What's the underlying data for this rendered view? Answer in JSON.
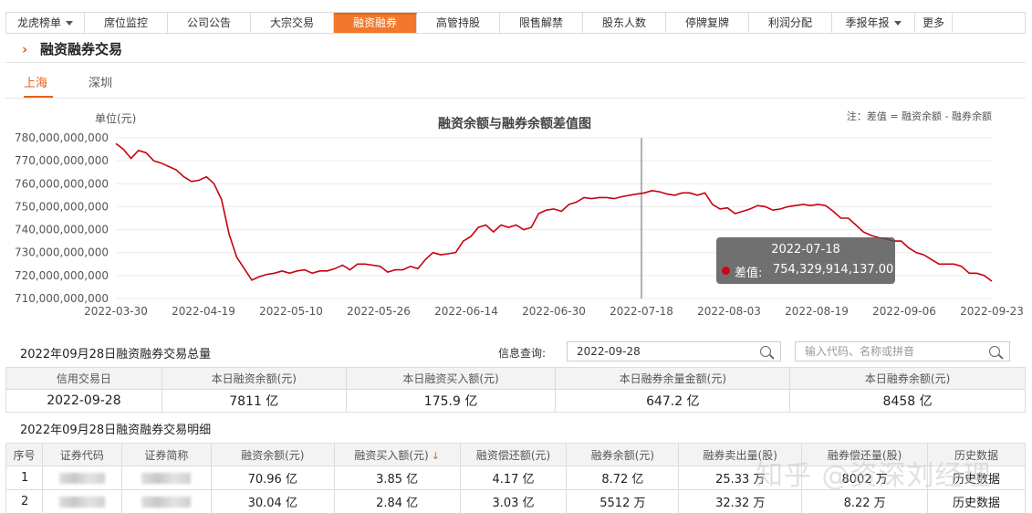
{
  "tabs": [
    {
      "label": "龙虎榜单",
      "dropdown": true
    },
    {
      "label": "席位监控"
    },
    {
      "label": "公司公告"
    },
    {
      "label": "大宗交易"
    },
    {
      "label": "融资融券",
      "active": true
    },
    {
      "label": "高管持股"
    },
    {
      "label": "限售解禁"
    },
    {
      "label": "股东人数"
    },
    {
      "label": "停牌复牌"
    },
    {
      "label": "利润分配"
    },
    {
      "label": "季报年报",
      "dropdown": true
    },
    {
      "label": "更多"
    }
  ],
  "section": {
    "title": "融资融券交易"
  },
  "markets": {
    "shanghai": "上海",
    "shenzhen": "深圳"
  },
  "chart_data": {
    "type": "line",
    "title": "融资余额与融券余额差值图",
    "ylabel": "单位(元)",
    "note": "注：差值 = 融资余额 - 融券余额",
    "series_name": "差值",
    "ylim": [
      710000000000,
      780000000000
    ],
    "y_ticks": [
      "780,000,000,000",
      "770,000,000,000",
      "760,000,000,000",
      "750,000,000,000",
      "740,000,000,000",
      "730,000,000,000",
      "720,000,000,000",
      "710,000,000,000"
    ],
    "x_ticks": [
      "2022-03-30",
      "2022-04-19",
      "2022-05-10",
      "2022-05-26",
      "2022-06-14",
      "2022-06-30",
      "2022-07-18",
      "2022-08-03",
      "2022-08-19",
      "2022-09-06",
      "2022-09-23"
    ],
    "values": [
      777.5,
      775,
      771,
      774.5,
      773.5,
      770,
      769,
      767.5,
      766,
      763,
      761,
      761.5,
      763,
      760,
      753,
      738,
      728,
      723,
      718,
      719.5,
      720.5,
      721,
      722,
      721,
      722,
      722.5,
      721,
      722,
      722,
      723,
      724.5,
      722.5,
      725,
      725,
      724.5,
      724,
      721.5,
      722.5,
      722.5,
      724,
      723,
      727,
      730,
      729,
      729.5,
      730,
      735,
      737,
      741,
      742,
      739,
      742,
      741,
      742,
      740,
      741,
      747,
      748.5,
      749,
      748,
      751,
      752,
      754,
      753.5,
      754,
      754,
      753.5,
      754.33,
      755,
      755.5,
      756,
      757,
      756.5,
      755.5,
      755,
      756,
      756,
      755,
      756,
      751,
      749,
      749.5,
      747,
      748,
      749,
      750.5,
      750,
      748.5,
      749,
      750,
      750.5,
      751,
      750.5,
      751,
      750.5,
      748,
      745,
      745,
      742,
      739,
      737.5,
      736.5,
      736,
      735,
      735,
      732,
      730,
      729,
      727,
      725,
      725,
      725,
      724,
      721,
      721,
      720,
      717.5
    ],
    "tooltip": {
      "date": "2022-07-18",
      "label": "差值:",
      "value": "754,329,914,137.00"
    }
  },
  "total": {
    "title": "2022年09月28日融资融券交易总量",
    "query_label": "信息查询:",
    "date_value": "2022-09-28",
    "code_placeholder": "输入代码、名称或拼音",
    "headers": [
      "信用交易日",
      "本日融资余额(元)",
      "本日融资买入额(元)",
      "本日融券余量金额(元)",
      "本日融券余额(元)"
    ],
    "row": [
      "2022-09-28",
      "7811 亿",
      "175.9 亿",
      "647.2 亿",
      "8458 亿"
    ]
  },
  "detail": {
    "title": "2022年09月28日融资融券交易明细",
    "headers": [
      "序号",
      "证券代码",
      "证券简称",
      "融资余额(元)",
      "融资买入额(元)",
      "融资偿还额(元)",
      "融券余额(元)",
      "融券卖出量(股)",
      "融券偿还量(股)",
      "历史数据"
    ],
    "rows": [
      [
        "1",
        "",
        "",
        "70.96 亿",
        "3.85 亿",
        "4.17 亿",
        "8.72 亿",
        "25.33 万",
        "8002 万",
        "历史数据"
      ],
      [
        "2",
        "",
        "",
        "30.04 亿",
        "2.84 亿",
        "3.03 亿",
        "5512 万",
        "32.32 万",
        "8.22 万",
        "历史数据"
      ]
    ]
  },
  "watermark": "知乎 @资深刘经理",
  "colors": {
    "accent": "#e8601b",
    "line": "#c8000f"
  }
}
